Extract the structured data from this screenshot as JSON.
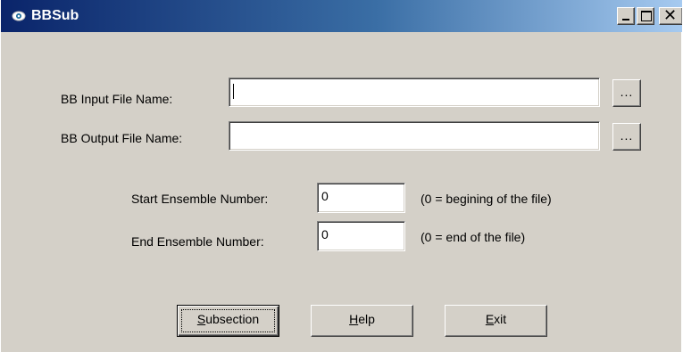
{
  "window": {
    "title": "BBSub",
    "icon": "gear-app-icon"
  },
  "caption_buttons": {
    "minimize": "minimize-icon",
    "maximize": "maximize-icon",
    "close": "close-icon"
  },
  "form": {
    "input_file": {
      "label": "BB Input File Name:",
      "value": "",
      "browse_label": "..."
    },
    "output_file": {
      "label": "BB Output File Name:",
      "value": "",
      "browse_label": "..."
    },
    "start_ensemble": {
      "label": "Start Ensemble Number:",
      "value": "0",
      "hint": "(0 = begining of the file)"
    },
    "end_ensemble": {
      "label": "End Ensemble Number:",
      "value": "0",
      "hint": "(0 = end of the file)"
    }
  },
  "buttons": {
    "subsection": {
      "mnemonic": "S",
      "rest": "ubsection"
    },
    "help": {
      "mnemonic": "H",
      "rest": "elp"
    },
    "exit": {
      "mnemonic": "E",
      "rest": "xit"
    }
  }
}
